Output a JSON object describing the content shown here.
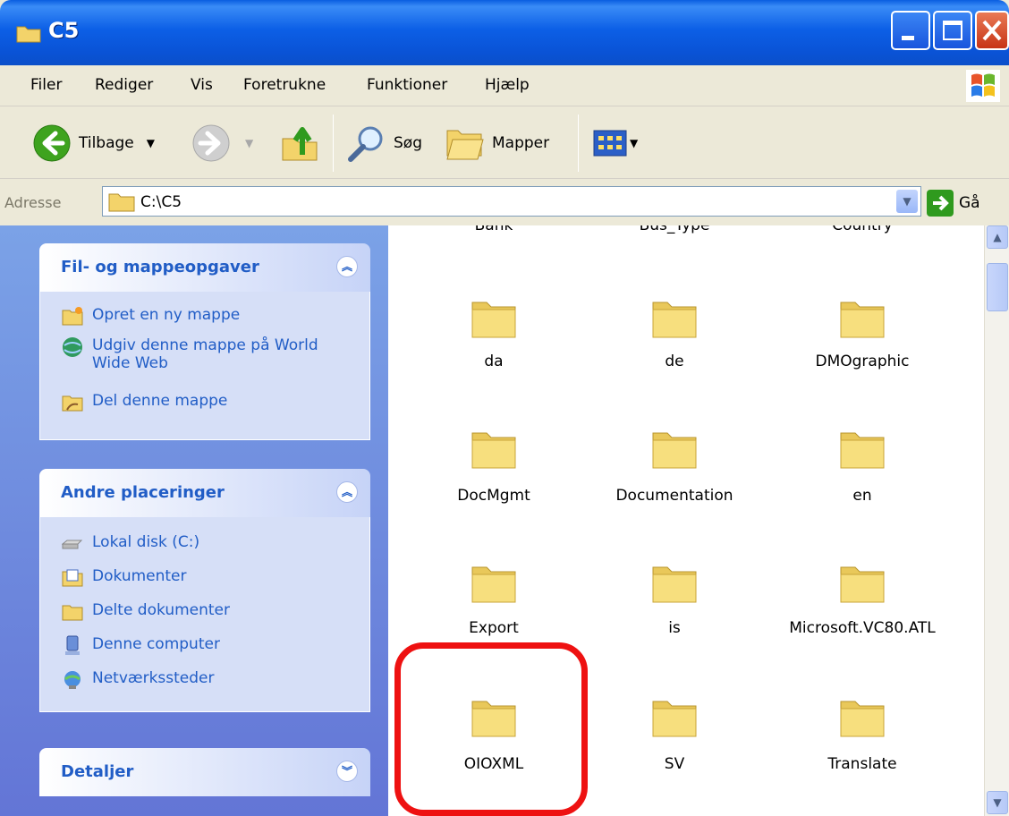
{
  "window": {
    "title": "C5"
  },
  "menu": [
    "Filer",
    "Rediger",
    "Vis",
    "Foretrukne",
    "Funktioner",
    "Hjælp"
  ],
  "toolbar": {
    "back_label": "Tilbage",
    "search_label": "Søg",
    "folders_label": "Mapper"
  },
  "address": {
    "label": "Adresse",
    "value": "C:\\C5",
    "go_label": "Gå"
  },
  "taskpane": {
    "file_tasks": {
      "title": "Fil- og mappeopgaver",
      "items": [
        "Opret en ny mappe",
        "Udgiv denne mappe på World Wide Web",
        "Del denne mappe"
      ]
    },
    "other_places": {
      "title": "Andre placeringer",
      "items": [
        "Lokal disk (C:)",
        "Dokumenter",
        "Delte dokumenter",
        "Denne computer",
        "Netværkssteder"
      ]
    },
    "details": {
      "title": "Detaljer"
    }
  },
  "folders": [
    "Bank",
    "Bus_Type",
    "Country",
    "da",
    "de",
    "DMOgraphic",
    "DocMgmt",
    "Documentation",
    "en",
    "Export",
    "is",
    "Microsoft.VC80.ATL",
    "OIOXML",
    "SV",
    "Translate"
  ],
  "colors": {
    "titlebar": "#0a5ee0",
    "taskpane": "#7ba2e7",
    "link": "#215dc6",
    "highlight": "#ee1111",
    "folder": "#f7df7e"
  }
}
